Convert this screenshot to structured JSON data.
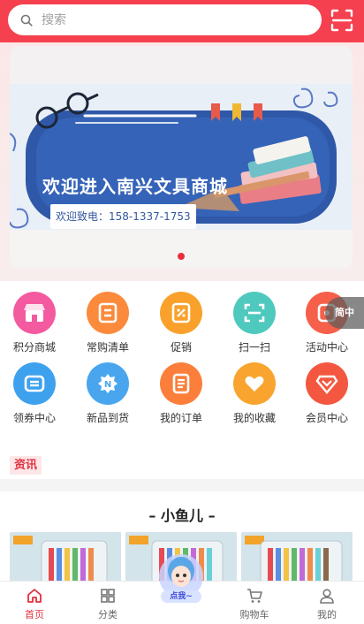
{
  "search": {
    "placeholder": "搜索"
  },
  "banner": {
    "title": "欢迎进入南兴文具商城",
    "phone": "欢迎致电：158-1337-1753"
  },
  "simple_badge": "简中",
  "grid": [
    {
      "label": "积分商城",
      "icon": "shop-icon",
      "color": "#f45aa0"
    },
    {
      "label": "常购清单",
      "icon": "cart-list-icon",
      "color": "#fb8a3c"
    },
    {
      "label": "促销",
      "icon": "discount-icon",
      "color": "#f9a12a"
    },
    {
      "label": "扫一扫",
      "icon": "scan-icon",
      "color": "#4fc9be"
    },
    {
      "label": "活动中心",
      "icon": "activity-icon",
      "color": "#f6604a"
    },
    {
      "label": "领券中心",
      "icon": "coupon-icon",
      "color": "#3ea1ee"
    },
    {
      "label": "新品到货",
      "icon": "new-icon",
      "color": "#49a6ee"
    },
    {
      "label": "我的订单",
      "icon": "order-icon",
      "color": "#fb7f3b"
    },
    {
      "label": "我的收藏",
      "icon": "favorite-icon",
      "color": "#f9a42e"
    },
    {
      "label": "会员中心",
      "icon": "member-icon",
      "color": "#f4573f"
    }
  ],
  "news": {
    "tag": "资讯"
  },
  "section": {
    "title": "– 小鱼儿 –"
  },
  "fab": {
    "label": "点我~"
  },
  "tabs": [
    {
      "label": "首页",
      "icon": "home-icon",
      "active": true
    },
    {
      "label": "分类",
      "icon": "category-icon",
      "active": false
    },
    {
      "label": "购物车",
      "icon": "cart-icon",
      "active": false
    },
    {
      "label": "我的",
      "icon": "user-icon",
      "active": false
    }
  ],
  "colors": {
    "brand": "#f5404f",
    "accent": "#e33040"
  }
}
